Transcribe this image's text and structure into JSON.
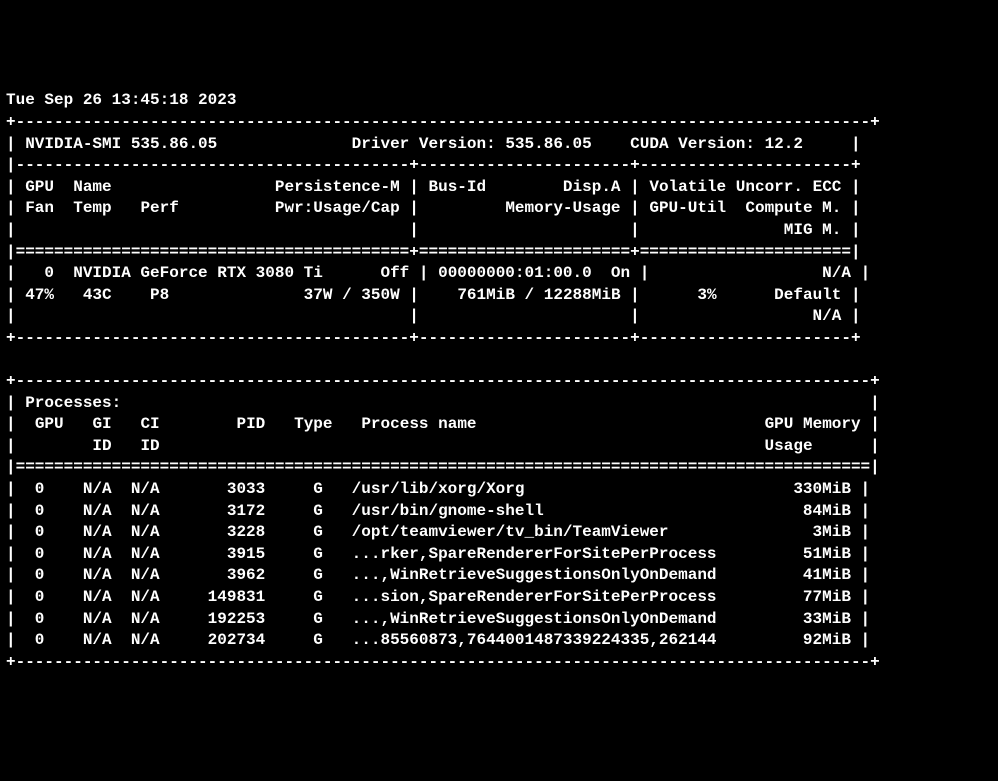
{
  "timestamp": "Tue Sep 26 13:45:18 2023",
  "header": {
    "smi_label": "NVIDIA-SMI",
    "smi_version": "535.86.05",
    "driver_label": "Driver Version:",
    "driver_version": "535.86.05",
    "cuda_label": "CUDA Version:",
    "cuda_version": "12.2"
  },
  "col_headers": {
    "gpu": "GPU",
    "name": "Name",
    "persistence": "Persistence-M",
    "busid": "Bus-Id",
    "disp": "Disp.A",
    "volatile": "Volatile",
    "uncorr": "Uncorr.",
    "ecc": "ECC",
    "fan": "Fan",
    "temp": "Temp",
    "perf": "Perf",
    "pwr": "Pwr:Usage/Cap",
    "memusage": "Memory-Usage",
    "gpuutil": "GPU-Util",
    "compute": "Compute M.",
    "mig": "MIG M."
  },
  "gpu": {
    "index": "0",
    "name": "NVIDIA GeForce RTX 3080 Ti",
    "persistence": "Off",
    "busid": "00000000:01:00.0",
    "disp": "On",
    "ecc": "N/A",
    "fan": "47%",
    "temp": "43C",
    "perf": "P8",
    "pwr_usage": "37W",
    "pwr_cap": "350W",
    "mem_used": "761MiB",
    "mem_total": "12288MiB",
    "gpu_util": "3%",
    "compute": "Default",
    "mig": "N/A"
  },
  "proc_section": {
    "title": "Processes:",
    "hdr_gpu": "GPU",
    "hdr_gi": "GI",
    "hdr_ci": "CI",
    "hdr_pid": "PID",
    "hdr_type": "Type",
    "hdr_pname": "Process name",
    "hdr_gpumem": "GPU Memory",
    "hdr_id": "ID",
    "hdr_usage": "Usage"
  },
  "processes": [
    {
      "gpu": "0",
      "gi": "N/A",
      "ci": "N/A",
      "pid": "3033",
      "type": "G",
      "name": "/usr/lib/xorg/Xorg",
      "mem": "330MiB"
    },
    {
      "gpu": "0",
      "gi": "N/A",
      "ci": "N/A",
      "pid": "3172",
      "type": "G",
      "name": "/usr/bin/gnome-shell",
      "mem": "84MiB"
    },
    {
      "gpu": "0",
      "gi": "N/A",
      "ci": "N/A",
      "pid": "3228",
      "type": "G",
      "name": "/opt/teamviewer/tv_bin/TeamViewer",
      "mem": "3MiB"
    },
    {
      "gpu": "0",
      "gi": "N/A",
      "ci": "N/A",
      "pid": "3915",
      "type": "G",
      "name": "...rker,SpareRendererForSitePerProcess",
      "mem": "51MiB"
    },
    {
      "gpu": "0",
      "gi": "N/A",
      "ci": "N/A",
      "pid": "3962",
      "type": "G",
      "name": "...,WinRetrieveSuggestionsOnlyOnDemand",
      "mem": "41MiB"
    },
    {
      "gpu": "0",
      "gi": "N/A",
      "ci": "N/A",
      "pid": "149831",
      "type": "G",
      "name": "...sion,SpareRendererForSitePerProcess",
      "mem": "77MiB"
    },
    {
      "gpu": "0",
      "gi": "N/A",
      "ci": "N/A",
      "pid": "192253",
      "type": "G",
      "name": "...,WinRetrieveSuggestionsOnlyOnDemand",
      "mem": "33MiB"
    },
    {
      "gpu": "0",
      "gi": "N/A",
      "ci": "N/A",
      "pid": "202734",
      "type": "G",
      "name": "...85560873,7644001487339224335,262144",
      "mem": "92MiB"
    }
  ]
}
